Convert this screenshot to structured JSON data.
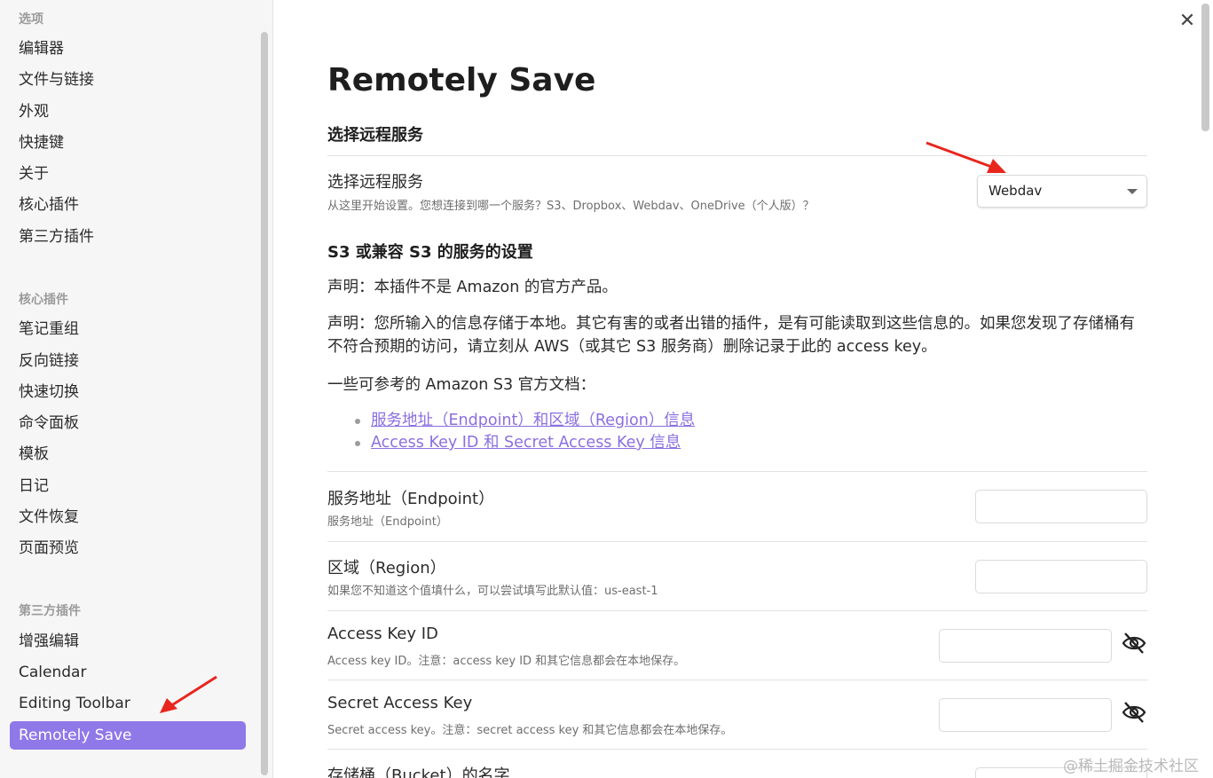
{
  "sidebar": {
    "group_options": "选项",
    "options_items": [
      "编辑器",
      "文件与链接",
      "外观",
      "快捷键",
      "关于",
      "核心插件",
      "第三方插件"
    ],
    "group_core": "核心插件",
    "core_items": [
      "笔记重组",
      "反向链接",
      "快速切换",
      "命令面板",
      "模板",
      "日记",
      "文件恢复",
      "页面预览"
    ],
    "group_third": "第三方插件",
    "third_items": [
      "增强编辑",
      "Calendar",
      "Editing Toolbar",
      "Remotely Save"
    ],
    "active_item": "Remotely Save"
  },
  "main": {
    "title": "Remotely Save",
    "section_remote": "选择远程服务",
    "remote_setting": {
      "name": "选择远程服务",
      "desc": "从这里开始设置。您想连接到哪一个服务？S3、Dropbox、Webdav、OneDrive（个人版）？",
      "selected": "Webdav"
    },
    "section_s3": "S3 或兼容 S3 的服务的设置",
    "disclaimer1": "声明：本插件不是 Amazon 的官方产品。",
    "disclaimer2": "声明：您所输入的信息存储于本地。其它有害的或者出错的插件，是有可能读取到这些信息的。如果您发现了存储桶有不符合预期的访问，请立刻从 AWS（或其它 S3 服务商）删除记录于此的 access key。",
    "docs_intro": "一些可参考的 Amazon S3 官方文档：",
    "doc_links": [
      "服务地址（Endpoint）和区域（Region）信息",
      "Access Key ID 和 Secret Access Key 信息"
    ],
    "settings": {
      "endpoint": {
        "name": "服务地址（Endpoint）",
        "desc": "服务地址（Endpoint）"
      },
      "region": {
        "name": "区域（Region）",
        "desc": "如果您不知道这个值填什么，可以尝试填写此默认值：us-east-1"
      },
      "access_key": {
        "name": "Access Key ID",
        "desc": "Access key ID。注意：access key ID 和其它信息都会在本地保存。"
      },
      "secret_key": {
        "name": "Secret Access Key",
        "desc": "Secret access key。注意：secret access key 和其它信息都会在本地保存。"
      },
      "bucket": {
        "name": "存储桶（Bucket）的名字"
      }
    }
  },
  "close_icon": "close-icon",
  "eye_icon": "eye-off-icon",
  "watermark": "@稀土掘金技术社区",
  "colors": {
    "accent": "#8f78e8",
    "arrow": "#e8261e",
    "link": "#8a6fe0"
  }
}
